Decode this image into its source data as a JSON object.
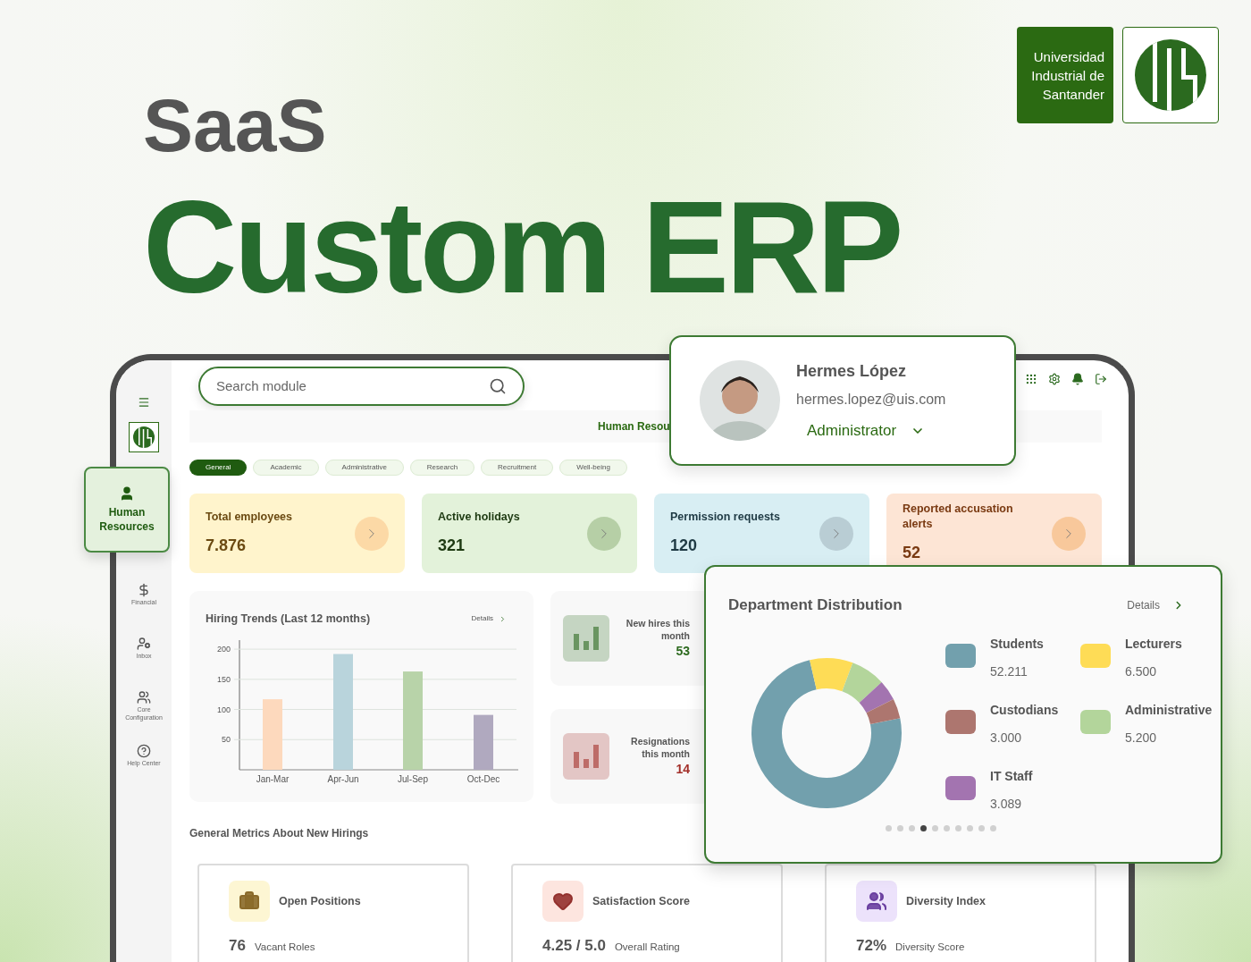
{
  "hero": {
    "eyebrow": "SaaS",
    "title": "Custom ERP"
  },
  "brand": {
    "name": "Universidad Industrial de Santander"
  },
  "search": {
    "placeholder": "Search module"
  },
  "header": {
    "title": "Human Resou"
  },
  "sidebar": {
    "active": {
      "label": "Human Resources"
    },
    "items": [
      {
        "kind": "financial",
        "label": "Financial"
      },
      {
        "kind": "inbox",
        "label": "Inbox"
      },
      {
        "kind": "config",
        "label": "Core Configuration"
      },
      {
        "kind": "help",
        "label": "Help Center"
      }
    ]
  },
  "tabs": [
    {
      "label": "General",
      "selected": true
    },
    {
      "label": "Academic",
      "selected": false
    },
    {
      "label": "Administrative",
      "selected": false
    },
    {
      "label": "Research",
      "selected": false
    },
    {
      "label": "Recruitment",
      "selected": false
    },
    {
      "label": "Well-being",
      "selected": false
    }
  ],
  "stats": [
    {
      "label": "Total employees",
      "value": "7.876",
      "color": "#fff4cc"
    },
    {
      "label": "Active holidays",
      "value": "321",
      "color": "#e3f2da"
    },
    {
      "label": "Permission requests",
      "value": "120",
      "color": "#d8eef3"
    },
    {
      "label": "Reported accusation alerts",
      "value": "52",
      "color": "#fde5d5"
    }
  ],
  "hiring": {
    "title": "Hiring Trends (Last 12 months)",
    "link": "Details",
    "chart_data": {
      "type": "bar",
      "categories": [
        "Jan-Mar",
        "Apr-Jun",
        "Jul-Sep",
        "Oct-Dec"
      ],
      "values": [
        117,
        192,
        163,
        91
      ],
      "colors": [
        "#fdd9bd",
        "#b9d4dc",
        "#b8d3a9",
        "#b0a9bf"
      ],
      "ylim": [
        0,
        215
      ],
      "yticks": [
        50,
        100,
        150,
        200
      ],
      "grid": true
    }
  },
  "monthly": [
    {
      "label": "New hires this month",
      "value": "53",
      "color": "#2d6a1f"
    },
    {
      "label": "Resignations this month",
      "value": "14",
      "color": "#a3302a"
    }
  ],
  "metrics": {
    "title": "General Metrics About New Hirings",
    "cards": [
      {
        "kind": "briefcase",
        "title": "Open Positions",
        "value": "76",
        "caption": "Vacant Roles"
      },
      {
        "kind": "heart",
        "title": "Satisfaction Score",
        "value": "4.25 / 5.0",
        "caption": "Overall Rating"
      },
      {
        "kind": "people",
        "title": "Diversity Index",
        "value": "72%",
        "caption": "Diversity Score"
      }
    ]
  },
  "profile": {
    "name": "Hermes López",
    "email": "hermes.lopez@uis.com",
    "role": "Administrator"
  },
  "departments": {
    "title": "Department Distribution",
    "link": "Details",
    "chart_data": {
      "type": "donut",
      "values": [
        74.59,
        9.29,
        7.43,
        4.41,
        4.28
      ],
      "colors": [
        "#72a0ad",
        "#fedc56",
        "#b3d59b",
        "#a374b0",
        "#ad766f"
      ]
    },
    "legend": [
      {
        "label": "Students",
        "value": "52.211",
        "color": "#72a0ad"
      },
      {
        "label": "Lecturers",
        "value": "6.500",
        "color": "#fedc56"
      },
      {
        "label": "Custodians",
        "value": "3.000",
        "color": "#ad766f"
      },
      {
        "label": "Administrative",
        "value": "5.200",
        "color": "#b3d59b"
      },
      {
        "label": "IT Staff",
        "value": "3.089",
        "color": "#a374b0"
      }
    ],
    "pages": [
      {
        "selected": false
      },
      {
        "selected": false
      },
      {
        "selected": false
      },
      {
        "selected": true
      },
      {
        "selected": false
      },
      {
        "selected": false
      },
      {
        "selected": false
      },
      {
        "selected": false
      },
      {
        "selected": false
      },
      {
        "selected": false
      }
    ]
  }
}
